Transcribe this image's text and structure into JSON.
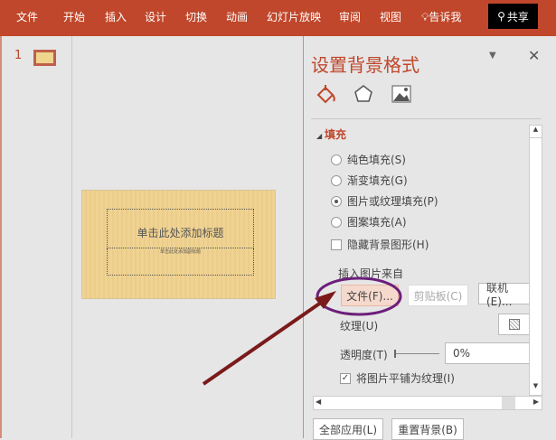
{
  "ribbon": {
    "tabs": [
      "文件",
      "开始",
      "插入",
      "设计",
      "切换",
      "动画",
      "幻灯片放映",
      "审阅",
      "视图"
    ],
    "tell_me": "告诉我",
    "share": "共享"
  },
  "thumbnails": {
    "slide_number": "1"
  },
  "slide": {
    "title_placeholder": "单击此处添加标题",
    "subtitle_placeholder": "单击此处添加副标题"
  },
  "pane": {
    "title": "设置背景格式",
    "section": "填充",
    "options": [
      {
        "label": "纯色填充(S)",
        "selected": false
      },
      {
        "label": "渐变填充(G)",
        "selected": false
      },
      {
        "label": "图片或纹理填充(P)",
        "selected": true
      },
      {
        "label": "图案填充(A)",
        "selected": false
      }
    ],
    "hide_bg": {
      "label": "隐藏背景图形(H)",
      "checked": false
    },
    "insert_from": "插入图片来自",
    "file_btn": "文件(F)...",
    "clipboard_btn": "剪贴板(C)",
    "online_btn": "联机(E)...",
    "texture": "纹理(U)",
    "transparency": {
      "label": "透明度(T)",
      "value": "0%"
    },
    "tile": {
      "label": "将图片平铺为纹理(I)",
      "checked": true
    },
    "apply_all": "全部应用(L)",
    "reset": "重置背景(B)"
  },
  "colors": {
    "accent": "#c0472b",
    "annotation_ellipse": "#6b1f7a",
    "annotation_arrow": "#7a1a1a"
  }
}
